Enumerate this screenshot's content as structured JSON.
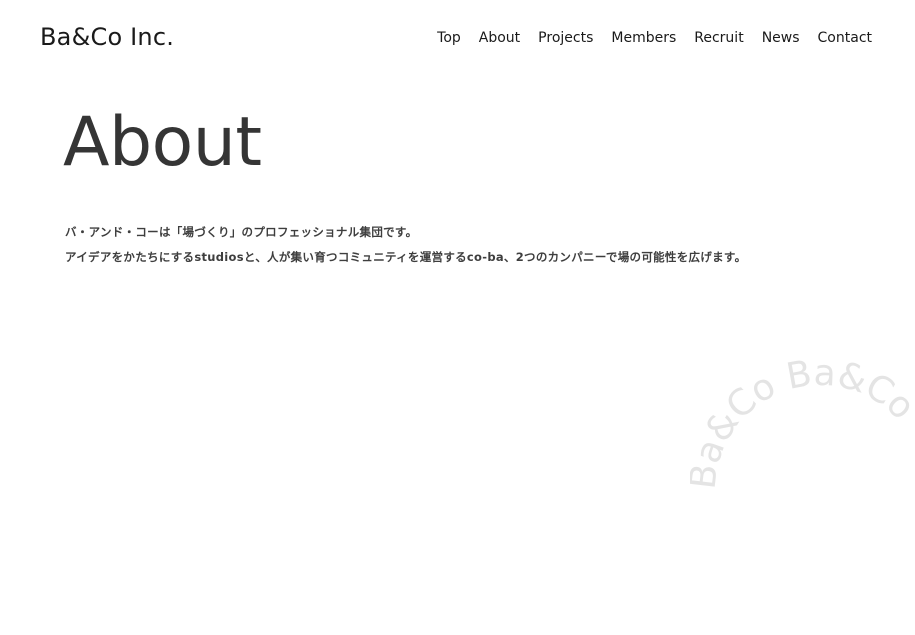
{
  "brand": {
    "logo_text": "Ba&Co Inc."
  },
  "nav": {
    "items": [
      {
        "label": "Top"
      },
      {
        "label": "About"
      },
      {
        "label": "Projects"
      },
      {
        "label": "Members"
      },
      {
        "label": "Recruit"
      },
      {
        "label": "News"
      },
      {
        "label": "Contact"
      }
    ]
  },
  "main": {
    "title": "About",
    "intro_lines": [
      "バ・アンド・コーは「場づくり」のプロフェッショナル集団です。",
      "アイデアをかたちにするstudiosと、人が集い育つコミュニティを運営するco-ba、2つのカンパニーで場の可能性を広げます。"
    ]
  },
  "decoration": {
    "ring_text": "Ba&Co Ba&Co",
    "color": "#e4e4e4"
  },
  "colors": {
    "background": "#ffffff",
    "text": "#1a1a1a",
    "title": "#353535",
    "body": "#3e3e3e"
  }
}
